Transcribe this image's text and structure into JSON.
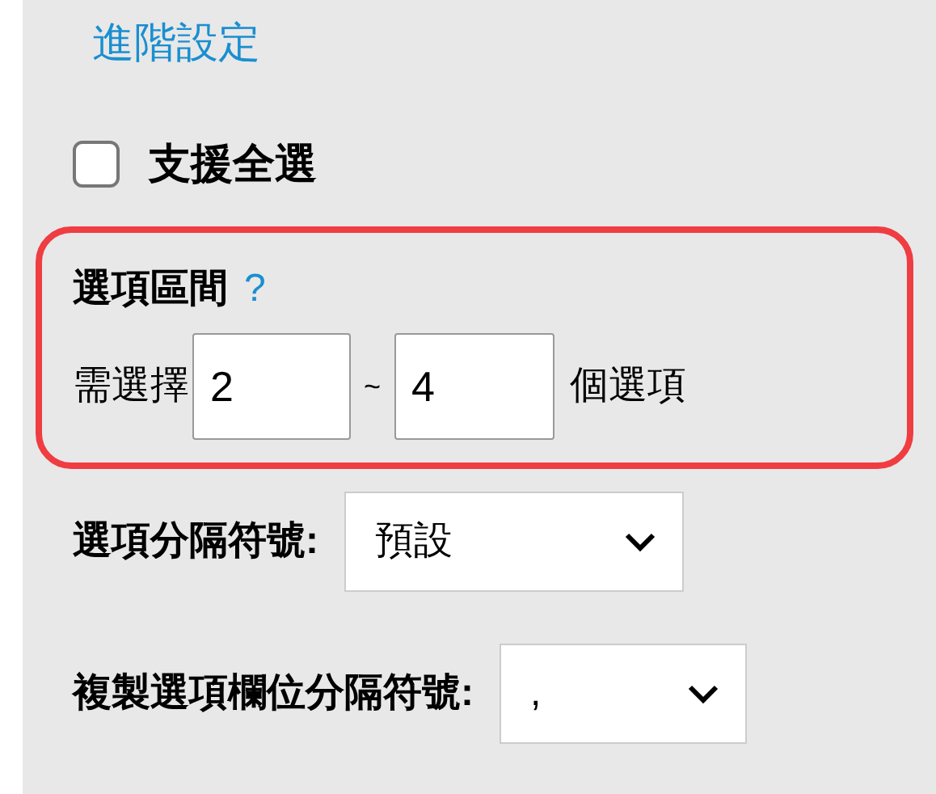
{
  "link": "進階設定",
  "select_all": {
    "label": "支援全選",
    "checked": false
  },
  "option_range": {
    "title": "選項區間",
    "help": "?",
    "prefix": "需選擇",
    "min": "2",
    "separator": "~",
    "max": "4",
    "suffix": "個選項"
  },
  "dropdowns": [
    {
      "label": "選項分隔符號:",
      "value": "預設"
    },
    {
      "label": "複製選項欄位分隔符號:",
      "value": ","
    }
  ]
}
